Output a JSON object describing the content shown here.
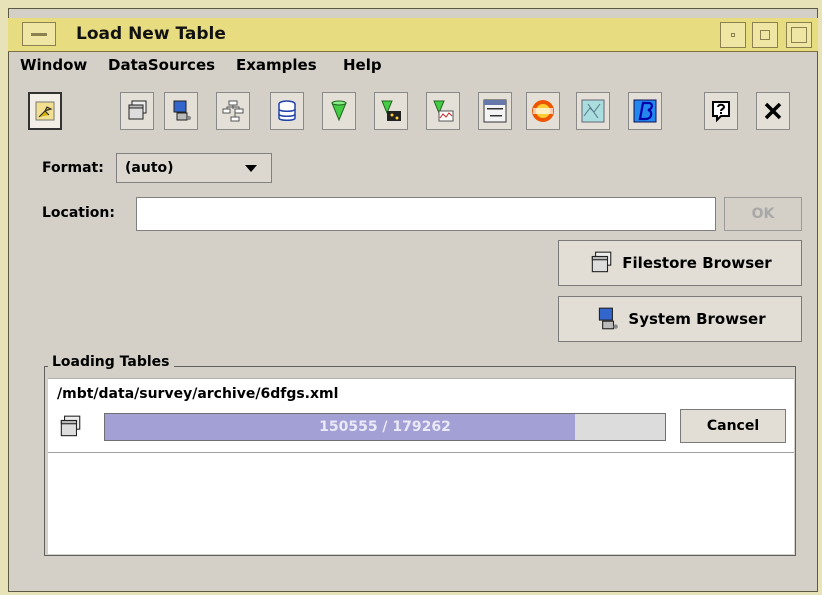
{
  "window": {
    "title": "Load New Table"
  },
  "menubar": {
    "items": [
      "Window",
      "DataSources",
      "Examples",
      "Help"
    ]
  },
  "toolbar": {
    "tools": [
      "pin-icon",
      "filestore-icon",
      "system-icon",
      "hierarchy-icon",
      "database-icon",
      "cone-icon",
      "cone-plot-icon",
      "cone-graph-icon",
      "select-from-icon",
      "vizier-icon",
      "sky-icon",
      "b-icon",
      "help-icon",
      "close-icon"
    ]
  },
  "form": {
    "format_label": "Format:",
    "format_value": "(auto)",
    "location_label": "Location:",
    "location_value": "",
    "ok_label": "OK"
  },
  "buttons": {
    "filestore": "Filestore Browser",
    "system": "System Browser"
  },
  "loading": {
    "group_title": "Loading Tables",
    "file_path": "/mbt/data/survey/archive/6dfgs.xml",
    "progress_text": "150555 / 179262",
    "progress_fraction": 0.8399,
    "cancel_label": "Cancel"
  },
  "colors": {
    "titlebar": "#e8dc80",
    "progress_fill": "#a3a0d5",
    "window_bg": "#d4d0c8"
  }
}
